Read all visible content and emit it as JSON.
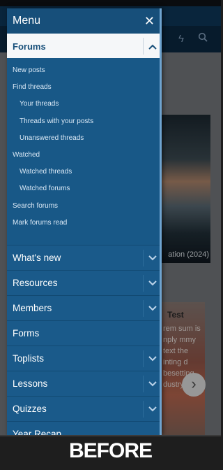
{
  "menu": {
    "title": "Menu",
    "close_icon": "close-icon",
    "active_section": {
      "label": "Forums",
      "toggle_icon": "chevron-up-icon",
      "items": [
        {
          "label": "New posts",
          "level": 1
        },
        {
          "label": "Find threads",
          "level": 1
        },
        {
          "label": "Your threads",
          "level": 2
        },
        {
          "label": "Threads with your posts",
          "level": 2
        },
        {
          "label": "Unanswered threads",
          "level": 2
        },
        {
          "label": "Watched",
          "level": 1
        },
        {
          "label": "Watched threads",
          "level": 2
        },
        {
          "label": "Watched forums",
          "level": 2
        },
        {
          "label": "Search forums",
          "level": 1
        },
        {
          "label": "Mark forums read",
          "level": 1
        }
      ]
    },
    "sections": [
      {
        "label": "What's new",
        "expandable": true
      },
      {
        "label": "Resources",
        "expandable": true
      },
      {
        "label": "Members",
        "expandable": true
      },
      {
        "label": "Forms",
        "expandable": false
      },
      {
        "label": "Toplists",
        "expandable": true
      },
      {
        "label": "Lessons",
        "expandable": true
      },
      {
        "label": "Quizzes",
        "expandable": true
      },
      {
        "label": "Year Recap",
        "expandable": false
      }
    ]
  },
  "background": {
    "poster_caption": "ation (2024)",
    "card_title": "Test",
    "card_text": "rem sum is nply mmy text the inting d besetting dustry. rem",
    "next_icon": "chevron-right-icon",
    "nav_icons": [
      "lightning-icon",
      "search-icon"
    ]
  },
  "footer": {
    "label": "BEFORE"
  },
  "colors": {
    "drawer": "#185887",
    "drawer_header": "#174f7a",
    "active_section_bg": "#f5f7f9",
    "accent_text": "#174f7a"
  }
}
